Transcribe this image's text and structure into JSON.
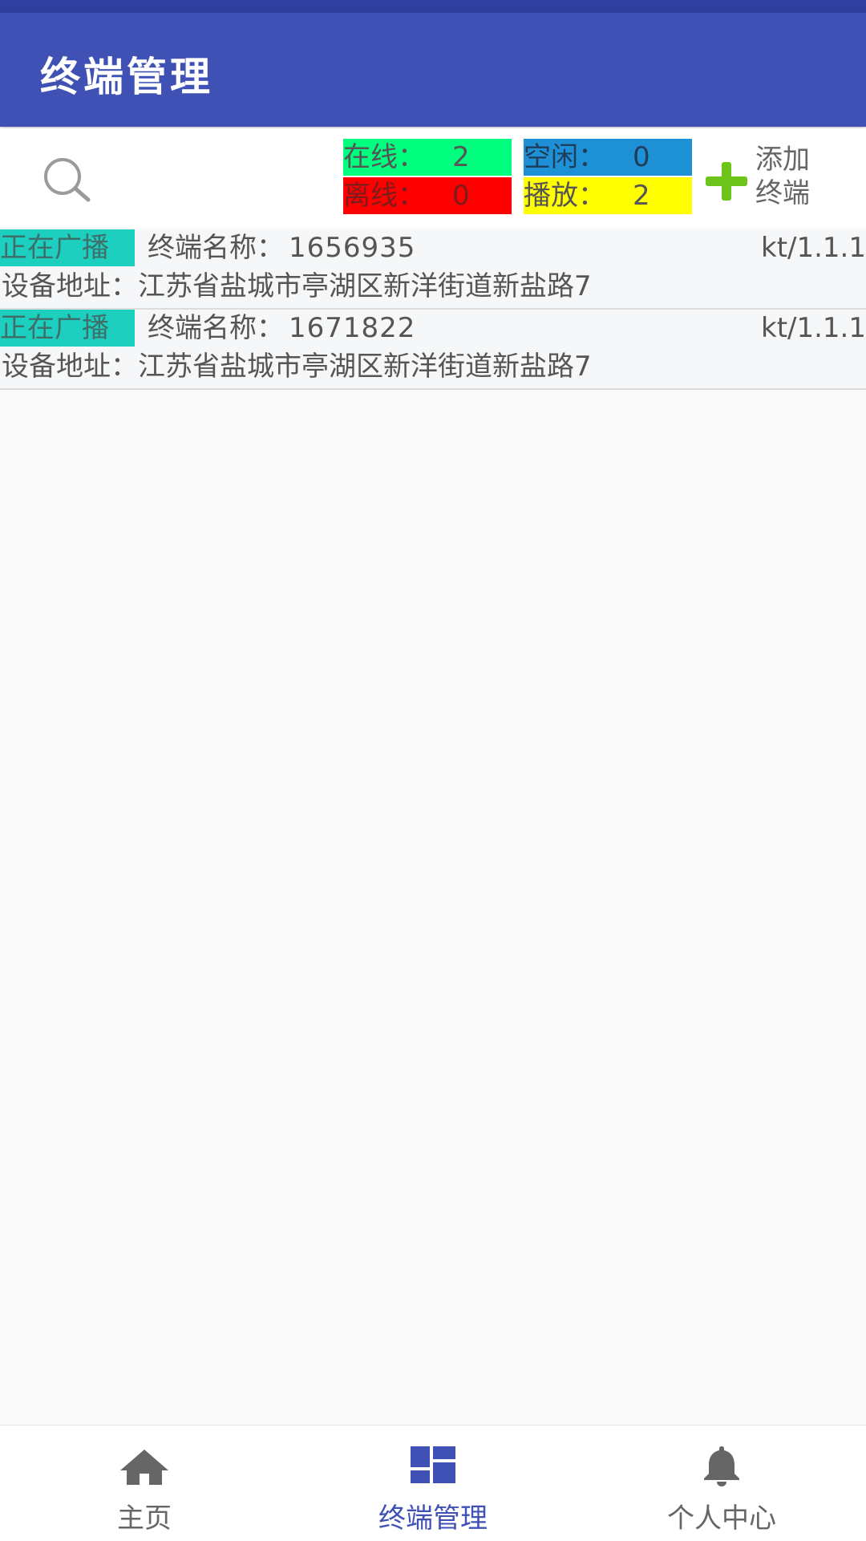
{
  "app_bar": {
    "title": "终端管理"
  },
  "stats": {
    "online": {
      "label": "在线：",
      "value": "2",
      "color": "#00ff7f"
    },
    "offline": {
      "label": "离线：",
      "value": "0",
      "color": "#ff0000"
    },
    "idle": {
      "label": "空闲：",
      "value": "0",
      "color": "#1e90d6"
    },
    "playing": {
      "label": "播放：",
      "value": "2",
      "color": "#ffff00"
    }
  },
  "add_terminal": {
    "line1": "添加",
    "line2": "终端",
    "icon": "plus-icon"
  },
  "search": {
    "icon": "search-icon"
  },
  "terminals": [
    {
      "status": "正在广播",
      "name_label": "终端名称：",
      "name": "1656935",
      "version": "kt/1.1.1",
      "address_label": "设备地址：",
      "address": "江苏省盐城市亭湖区新洋街道新盐路7"
    },
    {
      "status": "正在广播",
      "name_label": "终端名称：",
      "name": "1671822",
      "version": "kt/1.1.1",
      "address_label": "设备地址：",
      "address": "江苏省盐城市亭湖区新洋街道新盐路7"
    }
  ],
  "bottom_nav": {
    "items": [
      {
        "label": "主页",
        "icon": "home-icon",
        "active": false
      },
      {
        "label": "终端管理",
        "icon": "dashboard-icon",
        "active": true
      },
      {
        "label": "个人中心",
        "icon": "bell-icon",
        "active": false
      }
    ],
    "active_color": "#3f51b5"
  }
}
